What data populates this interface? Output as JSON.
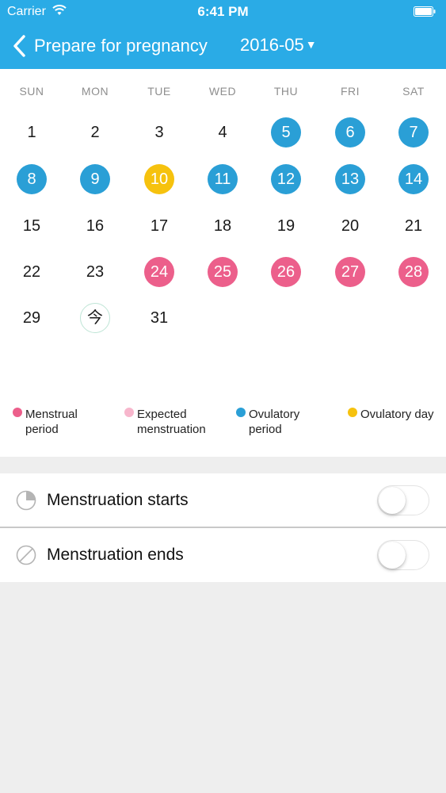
{
  "status_bar": {
    "carrier": "Carrier",
    "time": "6:41 PM"
  },
  "nav": {
    "title": "Prepare for pregnancy",
    "month": "2016-05",
    "caret": "▼"
  },
  "weekdays": [
    "SUN",
    "MON",
    "TUE",
    "WED",
    "THU",
    "FRI",
    "SAT"
  ],
  "calendar": {
    "weeks": [
      [
        {
          "d": "1",
          "s": ""
        },
        {
          "d": "2",
          "s": ""
        },
        {
          "d": "3",
          "s": ""
        },
        {
          "d": "4",
          "s": ""
        },
        {
          "d": "5",
          "s": "ovulatory_period"
        },
        {
          "d": "6",
          "s": "ovulatory_period"
        },
        {
          "d": "7",
          "s": "ovulatory_period"
        }
      ],
      [
        {
          "d": "8",
          "s": "ovulatory_period"
        },
        {
          "d": "9",
          "s": "ovulatory_period"
        },
        {
          "d": "10",
          "s": "ovulatory_day"
        },
        {
          "d": "11",
          "s": "ovulatory_period"
        },
        {
          "d": "12",
          "s": "ovulatory_period"
        },
        {
          "d": "13",
          "s": "ovulatory_period"
        },
        {
          "d": "14",
          "s": "ovulatory_period"
        }
      ],
      [
        {
          "d": "15",
          "s": ""
        },
        {
          "d": "16",
          "s": ""
        },
        {
          "d": "17",
          "s": ""
        },
        {
          "d": "18",
          "s": ""
        },
        {
          "d": "19",
          "s": ""
        },
        {
          "d": "20",
          "s": ""
        },
        {
          "d": "21",
          "s": ""
        }
      ],
      [
        {
          "d": "22",
          "s": ""
        },
        {
          "d": "23",
          "s": ""
        },
        {
          "d": "24",
          "s": "menstrual_period"
        },
        {
          "d": "25",
          "s": "menstrual_period"
        },
        {
          "d": "26",
          "s": "menstrual_period"
        },
        {
          "d": "27",
          "s": "menstrual_period"
        },
        {
          "d": "28",
          "s": "menstrual_period"
        }
      ],
      [
        {
          "d": "29",
          "s": ""
        },
        {
          "d": "今",
          "s": "today"
        },
        {
          "d": "31",
          "s": ""
        }
      ]
    ]
  },
  "legend": [
    {
      "label": "Menstrual period",
      "color": "#ec5f8b"
    },
    {
      "label": "Expected menstruation",
      "color": "#f7b6cc"
    },
    {
      "label": "Ovulatory period",
      "color": "#2a9fd6"
    },
    {
      "label": "Ovulatory day",
      "color": "#f6c20e"
    }
  ],
  "settings": [
    {
      "label": "Menstruation starts",
      "icon": "pie-icon",
      "on": false
    },
    {
      "label": "Menstruation ends",
      "icon": "slash-circle-icon",
      "on": false
    }
  ],
  "colors": {
    "header": "#2aabe6",
    "ovulatory_period": "#2a9fd6",
    "ovulatory_day": "#f6c20e",
    "menstrual_period": "#ec5f8b",
    "expected_menstruation": "#f7b6cc"
  }
}
